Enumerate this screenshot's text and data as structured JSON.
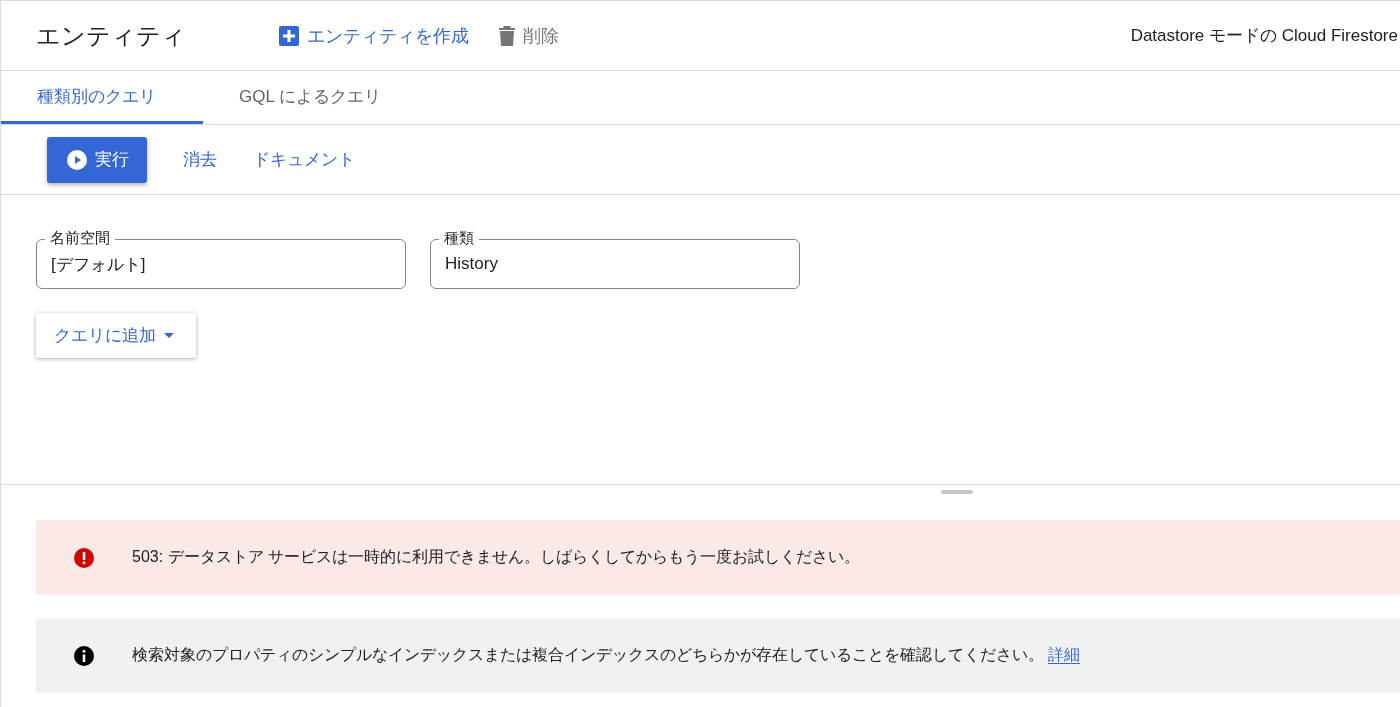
{
  "header": {
    "title": "エンティティ",
    "actions": [
      {
        "kind": "create",
        "label": "エンティティを作成",
        "disabled": false
      },
      {
        "kind": "delete",
        "label": "削除",
        "disabled": true
      }
    ],
    "product": "Datastore モードの Cloud Firestore"
  },
  "tabs": [
    {
      "label": "種類別のクエリ",
      "selected": true
    },
    {
      "label": "GQL によるクエリ",
      "selected": false
    }
  ],
  "toolbar": {
    "run": "実行",
    "links": [
      "消去",
      "ドキュメント"
    ]
  },
  "fields": [
    {
      "label": "名前空間",
      "value": "[デフォルト]"
    },
    {
      "label": "種類",
      "value": "History"
    }
  ],
  "add_to_query": "クエリに追加",
  "alerts": [
    {
      "kind": "error",
      "text": "503: データストア サービスは一時的に利用できません。しばらくしてからもう一度お試しください。"
    },
    {
      "kind": "info",
      "text": "検索対象のプロパティのシンプルなインデックスまたは複合インデックスのどちらかが存在していることを確認してください。",
      "link": "詳細"
    }
  ]
}
